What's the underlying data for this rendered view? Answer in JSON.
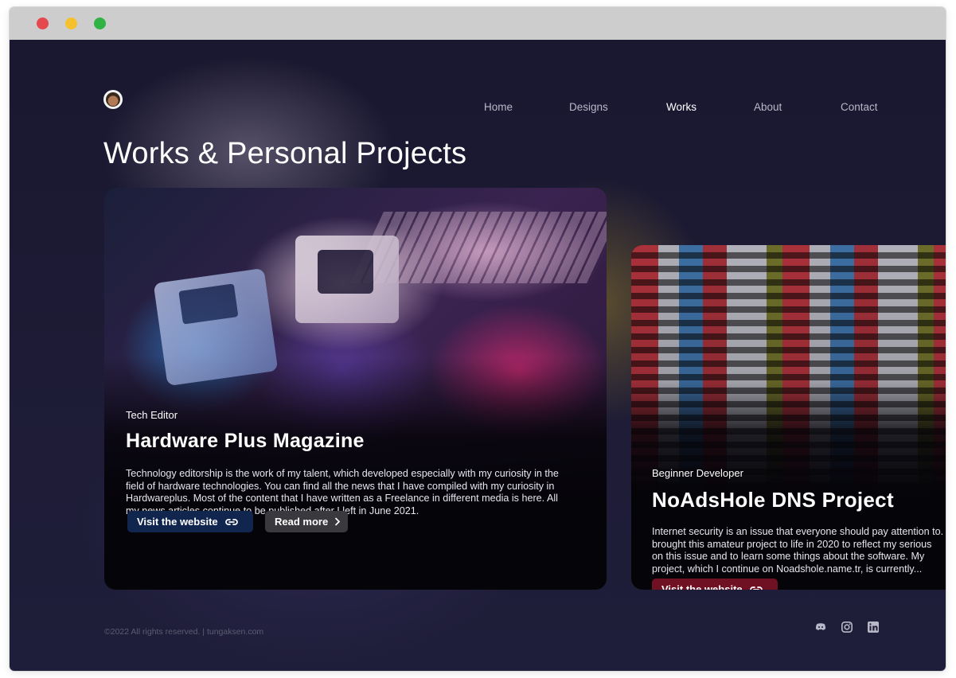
{
  "nav": {
    "items": [
      {
        "label": "Home"
      },
      {
        "label": "Designs"
      },
      {
        "label": "Works"
      },
      {
        "label": "About"
      },
      {
        "label": "Contact"
      }
    ],
    "active": "Works"
  },
  "page": {
    "title": "Works & Personal Projects"
  },
  "projects": [
    {
      "role": "Tech Editor",
      "title": "Hardware Plus Magazine",
      "description": "Technology editorship is the work of my talent, which developed especially with my curiosity in the field of hardware technologies. You can find all the news that I have compiled with my curiosity in Hardwareplus. Most of the content that I have written as a Freelance in different media is here. All my news articles continue to be published after I left in June 2021.",
      "visit_label": "Visit the website",
      "read_label": "Read more",
      "visit_color": "#11264f"
    },
    {
      "role": "Beginner Developer",
      "title": "NoAdsHole DNS Project",
      "description_lines": [
        "Internet security is an issue that everyone should pay attention to.",
        "brought this amateur project to life in 2020 to reflect my serious",
        "on this issue and to learn some things about the software. My",
        "project, which I continue on Noadshole.name.tr, is currently..."
      ],
      "visit_label": "Visit the website",
      "visit_color": "#6f1122"
    }
  ],
  "footer": {
    "copyright": "©2022 All rights reserved. | tungaksen.com",
    "social_icons": [
      "discord-icon",
      "instagram-icon",
      "linkedin-icon"
    ]
  },
  "colors": {
    "background": "#1d1b35",
    "accent_blue": "#11264f",
    "accent_red": "#6f1122"
  }
}
